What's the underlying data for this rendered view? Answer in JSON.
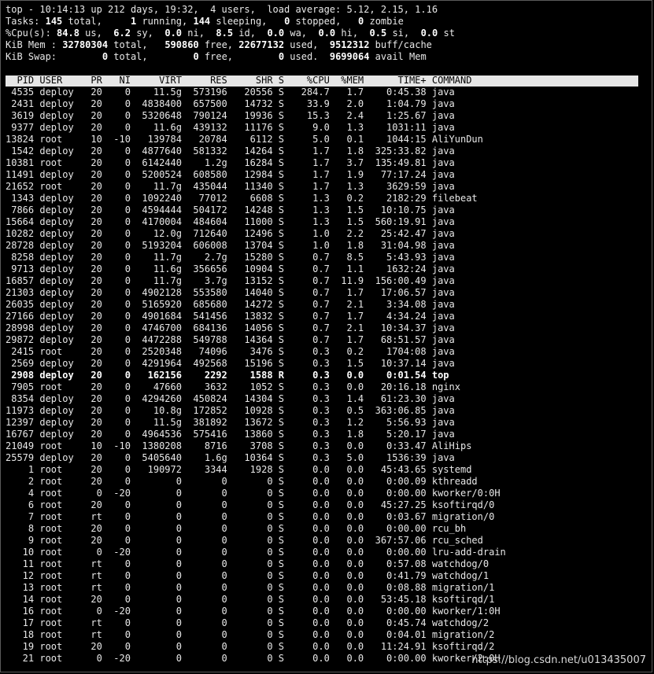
{
  "summary": {
    "line1": "top - 10:14:13 up 212 days, 19:32,  4 users,  load average: 5.12, 2.15, 1.16",
    "tasks": {
      "label": "Tasks:",
      "total": "145",
      "running": "1",
      "sleeping": "144",
      "stopped": "0",
      "zombie": "0"
    },
    "cpu": {
      "label": "%Cpu(s):",
      "us": "84.8",
      "sy": "6.2",
      "ni": "0.0",
      "id": "8.5",
      "wa": "0.0",
      "hi": "0.0",
      "si": "0.5",
      "st": "0.0"
    },
    "mem": {
      "label": "KiB Mem :",
      "total": "32780304",
      "free": "590860",
      "used": "22677132",
      "cache": "9512312"
    },
    "swap": {
      "label": "KiB Swap:",
      "total": "0",
      "free": "0",
      "used": "0",
      "avail": "9699064"
    }
  },
  "columns": [
    "PID",
    "USER",
    "PR",
    "NI",
    "VIRT",
    "RES",
    "SHR",
    "S",
    "%CPU",
    "%MEM",
    "TIME+",
    "COMMAND"
  ],
  "processes": [
    [
      "4535",
      "deploy",
      "20",
      "0",
      "11.5g",
      "573196",
      "20556",
      "S",
      "284.7",
      "1.7",
      "0:45.38",
      "java"
    ],
    [
      "2431",
      "deploy",
      "20",
      "0",
      "4838400",
      "657500",
      "14732",
      "S",
      "33.9",
      "2.0",
      "1:04.79",
      "java"
    ],
    [
      "3619",
      "deploy",
      "20",
      "0",
      "5320648",
      "790124",
      "19936",
      "S",
      "15.3",
      "2.4",
      "1:25.67",
      "java"
    ],
    [
      "9377",
      "deploy",
      "20",
      "0",
      "11.6g",
      "439132",
      "11176",
      "S",
      "9.0",
      "1.3",
      "1031:11",
      "java"
    ],
    [
      "13824",
      "root",
      "10",
      "-10",
      "139784",
      "20784",
      "6112",
      "S",
      "5.0",
      "0.1",
      "1044:15",
      "AliYunDun"
    ],
    [
      "1542",
      "deploy",
      "20",
      "0",
      "4877640",
      "581332",
      "14264",
      "S",
      "1.7",
      "1.8",
      "325:33.82",
      "java"
    ],
    [
      "10381",
      "root",
      "20",
      "0",
      "6142440",
      "1.2g",
      "16284",
      "S",
      "1.7",
      "3.7",
      "135:49.81",
      "java"
    ],
    [
      "11491",
      "deploy",
      "20",
      "0",
      "5200524",
      "608580",
      "12984",
      "S",
      "1.7",
      "1.9",
      "77:17.24",
      "java"
    ],
    [
      "21652",
      "root",
      "20",
      "0",
      "11.7g",
      "435044",
      "11340",
      "S",
      "1.7",
      "1.3",
      "3629:59",
      "java"
    ],
    [
      "1343",
      "deploy",
      "20",
      "0",
      "1092240",
      "77012",
      "6608",
      "S",
      "1.3",
      "0.2",
      "2182:29",
      "filebeat"
    ],
    [
      "7866",
      "deploy",
      "20",
      "0",
      "4594444",
      "504172",
      "14248",
      "S",
      "1.3",
      "1.5",
      "10:10.75",
      "java"
    ],
    [
      "15664",
      "deploy",
      "20",
      "0",
      "4170004",
      "484604",
      "11000",
      "S",
      "1.3",
      "1.5",
      "560:19.91",
      "java"
    ],
    [
      "10282",
      "deploy",
      "20",
      "0",
      "12.0g",
      "712640",
      "12496",
      "S",
      "1.0",
      "2.2",
      "25:42.47",
      "java"
    ],
    [
      "28728",
      "deploy",
      "20",
      "0",
      "5193204",
      "606008",
      "13704",
      "S",
      "1.0",
      "1.8",
      "31:04.98",
      "java"
    ],
    [
      "8258",
      "deploy",
      "20",
      "0",
      "11.7g",
      "2.7g",
      "15280",
      "S",
      "0.7",
      "8.5",
      "5:43.93",
      "java"
    ],
    [
      "9713",
      "deploy",
      "20",
      "0",
      "11.6g",
      "356656",
      "10904",
      "S",
      "0.7",
      "1.1",
      "1632:24",
      "java"
    ],
    [
      "16857",
      "deploy",
      "20",
      "0",
      "11.7g",
      "3.7g",
      "13152",
      "S",
      "0.7",
      "11.9",
      "156:00.49",
      "java"
    ],
    [
      "21303",
      "deploy",
      "20",
      "0",
      "4902128",
      "553580",
      "14040",
      "S",
      "0.7",
      "1.7",
      "17:06.57",
      "java"
    ],
    [
      "26035",
      "deploy",
      "20",
      "0",
      "5165920",
      "685680",
      "14272",
      "S",
      "0.7",
      "2.1",
      "3:34.08",
      "java"
    ],
    [
      "27166",
      "deploy",
      "20",
      "0",
      "4901684",
      "541456",
      "13832",
      "S",
      "0.7",
      "1.7",
      "4:34.24",
      "java"
    ],
    [
      "28998",
      "deploy",
      "20",
      "0",
      "4746700",
      "684136",
      "14056",
      "S",
      "0.7",
      "2.1",
      "10:34.37",
      "java"
    ],
    [
      "29872",
      "deploy",
      "20",
      "0",
      "4472288",
      "549788",
      "14364",
      "S",
      "0.7",
      "1.7",
      "68:51.57",
      "java"
    ],
    [
      "2415",
      "root",
      "20",
      "0",
      "2520348",
      "74096",
      "3476",
      "S",
      "0.3",
      "0.2",
      "1704:08",
      "java"
    ],
    [
      "2569",
      "deploy",
      "20",
      "0",
      "4291964",
      "492568",
      "15196",
      "S",
      "0.3",
      "1.5",
      "10:37.14",
      "java"
    ],
    [
      "2908",
      "deploy",
      "20",
      "0",
      "162156",
      "2292",
      "1588",
      "R",
      "0.3",
      "0.0",
      "0:01.54",
      "top"
    ],
    [
      "7905",
      "root",
      "20",
      "0",
      "47660",
      "3632",
      "1052",
      "S",
      "0.3",
      "0.0",
      "20:16.18",
      "nginx"
    ],
    [
      "8354",
      "deploy",
      "20",
      "0",
      "4294260",
      "450824",
      "14304",
      "S",
      "0.3",
      "1.4",
      "61:23.30",
      "java"
    ],
    [
      "11973",
      "deploy",
      "20",
      "0",
      "10.8g",
      "172852",
      "10928",
      "S",
      "0.3",
      "0.5",
      "363:06.85",
      "java"
    ],
    [
      "12397",
      "deploy",
      "20",
      "0",
      "11.5g",
      "381892",
      "13672",
      "S",
      "0.3",
      "1.2",
      "5:56.93",
      "java"
    ],
    [
      "16767",
      "deploy",
      "20",
      "0",
      "4964536",
      "575416",
      "13860",
      "S",
      "0.3",
      "1.8",
      "5:20.17",
      "java"
    ],
    [
      "21049",
      "root",
      "10",
      "-10",
      "1380208",
      "8716",
      "3708",
      "S",
      "0.3",
      "0.0",
      "0:33.47",
      "AliHips"
    ],
    [
      "25579",
      "deploy",
      "20",
      "0",
      "5405640",
      "1.6g",
      "10364",
      "S",
      "0.3",
      "5.0",
      "1536:39",
      "java"
    ],
    [
      "1",
      "root",
      "20",
      "0",
      "190972",
      "3344",
      "1928",
      "S",
      "0.0",
      "0.0",
      "45:43.65",
      "systemd"
    ],
    [
      "2",
      "root",
      "20",
      "0",
      "0",
      "0",
      "0",
      "S",
      "0.0",
      "0.0",
      "0:00.09",
      "kthreadd"
    ],
    [
      "4",
      "root",
      "0",
      "-20",
      "0",
      "0",
      "0",
      "S",
      "0.0",
      "0.0",
      "0:00.00",
      "kworker/0:0H"
    ],
    [
      "6",
      "root",
      "20",
      "0",
      "0",
      "0",
      "0",
      "S",
      "0.0",
      "0.0",
      "45:27.25",
      "ksoftirqd/0"
    ],
    [
      "7",
      "root",
      "rt",
      "0",
      "0",
      "0",
      "0",
      "S",
      "0.0",
      "0.0",
      "0:03.67",
      "migration/0"
    ],
    [
      "8",
      "root",
      "20",
      "0",
      "0",
      "0",
      "0",
      "S",
      "0.0",
      "0.0",
      "0:00.00",
      "rcu_bh"
    ],
    [
      "9",
      "root",
      "20",
      "0",
      "0",
      "0",
      "0",
      "S",
      "0.0",
      "0.0",
      "367:57.06",
      "rcu_sched"
    ],
    [
      "10",
      "root",
      "0",
      "-20",
      "0",
      "0",
      "0",
      "S",
      "0.0",
      "0.0",
      "0:00.00",
      "lru-add-drain"
    ],
    [
      "11",
      "root",
      "rt",
      "0",
      "0",
      "0",
      "0",
      "S",
      "0.0",
      "0.0",
      "0:57.08",
      "watchdog/0"
    ],
    [
      "12",
      "root",
      "rt",
      "0",
      "0",
      "0",
      "0",
      "S",
      "0.0",
      "0.0",
      "0:41.79",
      "watchdog/1"
    ],
    [
      "13",
      "root",
      "rt",
      "0",
      "0",
      "0",
      "0",
      "S",
      "0.0",
      "0.0",
      "0:08.88",
      "migration/1"
    ],
    [
      "14",
      "root",
      "20",
      "0",
      "0",
      "0",
      "0",
      "S",
      "0.0",
      "0.0",
      "53:45.18",
      "ksoftirqd/1"
    ],
    [
      "16",
      "root",
      "0",
      "-20",
      "0",
      "0",
      "0",
      "S",
      "0.0",
      "0.0",
      "0:00.00",
      "kworker/1:0H"
    ],
    [
      "17",
      "root",
      "rt",
      "0",
      "0",
      "0",
      "0",
      "S",
      "0.0",
      "0.0",
      "0:45.74",
      "watchdog/2"
    ],
    [
      "18",
      "root",
      "rt",
      "0",
      "0",
      "0",
      "0",
      "S",
      "0.0",
      "0.0",
      "0:04.01",
      "migration/2"
    ],
    [
      "19",
      "root",
      "20",
      "0",
      "0",
      "0",
      "0",
      "S",
      "0.0",
      "0.0",
      "11:24.91",
      "ksoftirqd/2"
    ],
    [
      "21",
      "root",
      "0",
      "-20",
      "0",
      "0",
      "0",
      "S",
      "0.0",
      "0.0",
      "0:00.00",
      "kworker/2:0H"
    ]
  ],
  "highlight_pid": "2908",
  "watermark": "https://blog.csdn.net/u013435007"
}
